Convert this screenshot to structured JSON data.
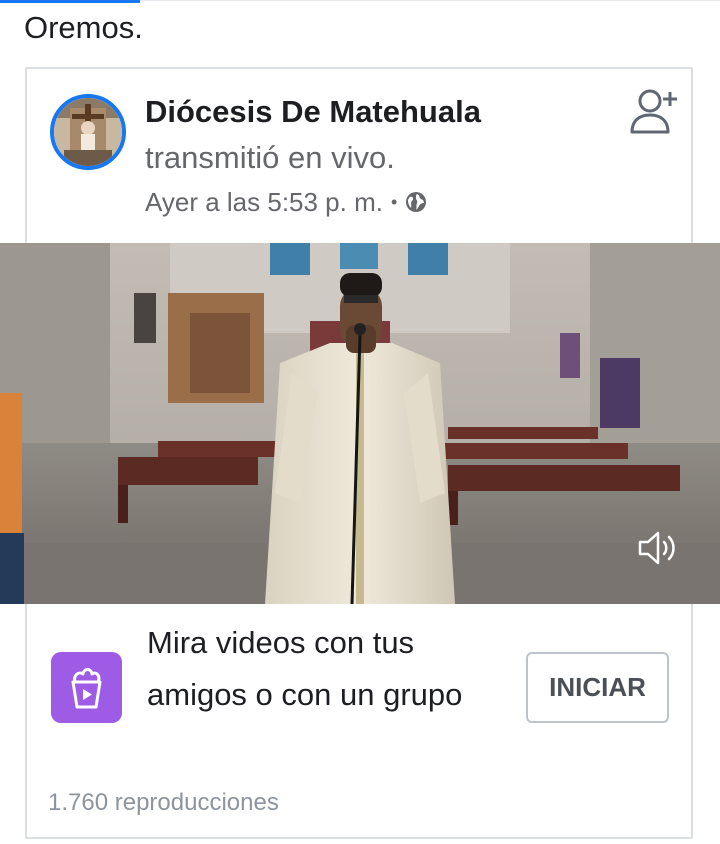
{
  "post": {
    "intro_text": "Oremos.",
    "page_name": "Diócesis De Matehuala",
    "live_text": "transmitió en vivo.",
    "timestamp": "Ayer a las 5:53 p. m.",
    "separator": "•",
    "audience_icon": "globe-icon",
    "follow_icon": "add-friend-icon"
  },
  "video": {
    "content": "priest-speaking-in-church-video",
    "sound_icon": "speaker-icon"
  },
  "watch_together": {
    "icon": "watch-party-icon",
    "text": "Mira videos con tus amigos o con un grupo",
    "button_label": "INICIAR"
  },
  "stats": {
    "views": "1.760 reproducciones"
  },
  "colors": {
    "accent": "#1877f2",
    "watch_icon_bg": "#9e5be6",
    "secondary_text": "#65676b"
  }
}
